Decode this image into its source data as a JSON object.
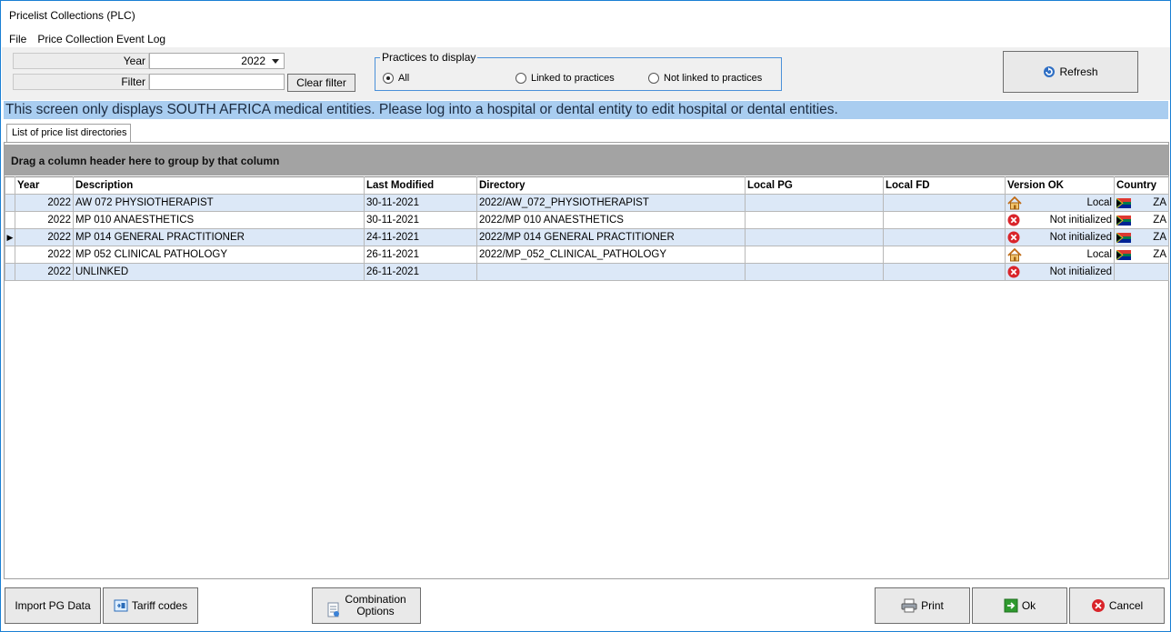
{
  "window": {
    "title": "Pricelist Collections (PLC)"
  },
  "menu": [
    "File",
    "Price Collection Event Log"
  ],
  "filters": {
    "year_label": "Year",
    "year_value": "2022",
    "filter_label": "Filter",
    "filter_value": "",
    "clear_button": "Clear filter"
  },
  "practices": {
    "legend": "Practices to display",
    "options": [
      "All",
      "Linked to practices",
      "Not linked to practices"
    ],
    "selected": "All"
  },
  "refresh_button": "Refresh",
  "banner": "This screen only displays SOUTH AFRICA medical entities. Please log into a hospital or dental entity to edit hospital or dental entities.",
  "tab": "List of price list directories",
  "group_hint": "Drag a column header here to group by that column",
  "grid": {
    "columns": [
      "Year",
      "Description",
      "Last Modified",
      "Directory",
      "Local PG",
      "Local FD",
      "Version OK",
      "Country"
    ],
    "rows": [
      {
        "year": "2022",
        "description": "AW 072 PHYSIOTHERAPIST",
        "last_modified": "30-11-2021",
        "directory": "2022/AW_072_PHYSIOTHERAPIST",
        "local_pg": "",
        "local_fd": "",
        "version_icon": "house-icon",
        "version": "Local",
        "country": "ZA",
        "current": false
      },
      {
        "year": "2022",
        "description": "MP 010 ANAESTHETICS",
        "last_modified": "30-11-2021",
        "directory": "2022/MP 010 ANAESTHETICS",
        "local_pg": "",
        "local_fd": "",
        "version_icon": "error-icon",
        "version": "Not initialized",
        "country": "ZA",
        "current": false
      },
      {
        "year": "2022",
        "description": "MP 014 GENERAL PRACTITIONER",
        "last_modified": "24-11-2021",
        "directory": "2022/MP 014 GENERAL PRACTITIONER",
        "local_pg": "",
        "local_fd": "",
        "version_icon": "error-icon",
        "version": "Not initialized",
        "country": "ZA",
        "current": true
      },
      {
        "year": "2022",
        "description": "MP 052 CLINICAL PATHOLOGY",
        "last_modified": "26-11-2021",
        "directory": "2022/MP_052_CLINICAL_PATHOLOGY",
        "local_pg": "",
        "local_fd": "",
        "version_icon": "house-icon",
        "version": "Local",
        "country": "ZA",
        "current": false
      },
      {
        "year": "2022",
        "description": "UNLINKED",
        "last_modified": "26-11-2021",
        "directory": "",
        "local_pg": "",
        "local_fd": "",
        "version_icon": "error-icon",
        "version": "Not initialized",
        "country": "",
        "current": false
      }
    ]
  },
  "footer": {
    "import_pg": "Import PG Data",
    "tariff_codes": "Tariff codes",
    "combination_line1": "Combination",
    "combination_line2": "Options",
    "print": "Print",
    "ok": "Ok",
    "cancel": "Cancel"
  },
  "colors": {
    "banner": "#a9cdf0",
    "alt_row": "#dce8f7",
    "group_bar": "#a3a3a3",
    "error": "#d9242a",
    "ok_green": "#2e9a2e"
  }
}
